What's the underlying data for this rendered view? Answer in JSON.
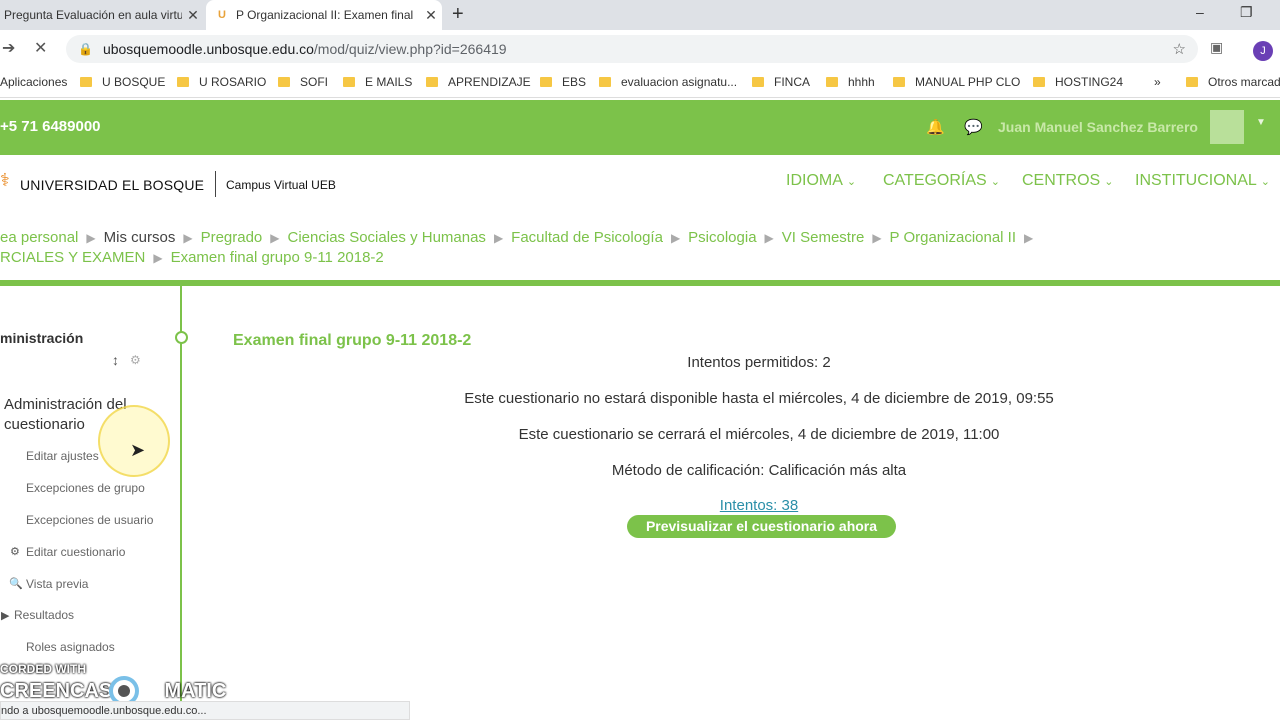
{
  "browser": {
    "tabs": [
      {
        "title": "Pregunta Evaluación en aula virtu"
      },
      {
        "title": "P Organizacional II: Examen final",
        "favicon": "U"
      }
    ],
    "new_tab": "+",
    "window_controls": {
      "minimize": "–",
      "restore": "❐"
    },
    "address": {
      "host": "ubosquemoodle.unbosque.edu.co",
      "path": "/mod/quiz/view.php?id=266419"
    },
    "bookmarks": [
      "Aplicaciones",
      "U BOSQUE",
      "U ROSARIO",
      "SOFI",
      "E MAILS",
      "APRENDIZAJE",
      "EBS",
      "evaluacion asignatu...",
      "FINCA",
      "hhhh",
      "MANUAL PHP CLO",
      "HOSTING24"
    ],
    "bookmarks_overflow": "»",
    "other_bookmarks": "Otros marcad",
    "profile_initial": "J",
    "status_text": "ndo a ubosquemoodle.unbosque.edu.co..."
  },
  "topbar": {
    "phone": "+5 71 6489000",
    "user_name": "Juan Manuel Sanchez Barrero"
  },
  "header": {
    "logo_text": "UNIVERSIDAD EL BOSQUE",
    "campus": "Campus Virtual UEB",
    "menu": [
      {
        "label": "IDIOMA"
      },
      {
        "label": "CATEGORÍAS"
      },
      {
        "label": "CENTROS"
      },
      {
        "label": "INSTITUCIONAL"
      }
    ]
  },
  "breadcrumb": {
    "line1": [
      "ea personal",
      "Mis cursos",
      "Pregrado",
      "Ciencias Sociales y Humanas",
      "Facultad de Psicología",
      "Psicologia",
      "VI Semestre",
      "P Organizacional II"
    ],
    "line2": [
      "RCIALES Y EXAMEN",
      "Examen final grupo 9-11 2018-2"
    ]
  },
  "sidebar": {
    "title": "ministración",
    "section": "Administración del cuestionario",
    "links": [
      {
        "label": "Editar ajustes"
      },
      {
        "label": "Excepciones de grupo"
      },
      {
        "label": "Excepciones de usuario"
      },
      {
        "label": "Editar cuestionario"
      },
      {
        "label": "Vista previa"
      },
      {
        "label": "Resultados"
      },
      {
        "label": "Roles asignados"
      }
    ]
  },
  "quiz": {
    "title": "Examen final grupo 9-11 2018-2",
    "attempts_allowed": "Intentos permitidos: 2",
    "open_info": "Este cuestionario no estará disponible hasta el miércoles, 4 de diciembre de 2019, 09:55",
    "close_info": "Este cuestionario se cerrará el miércoles, 4 de diciembre de 2019, 11:00",
    "grading": "Método de calificación: Calificación más alta",
    "attempts_link": "Intentos: 38",
    "preview_button": "Previsualizar el cuestionario ahora"
  },
  "watermark": {
    "line1": "CORDED WITH",
    "line2a": "CREENCAST",
    "line2b": "MATIC"
  }
}
